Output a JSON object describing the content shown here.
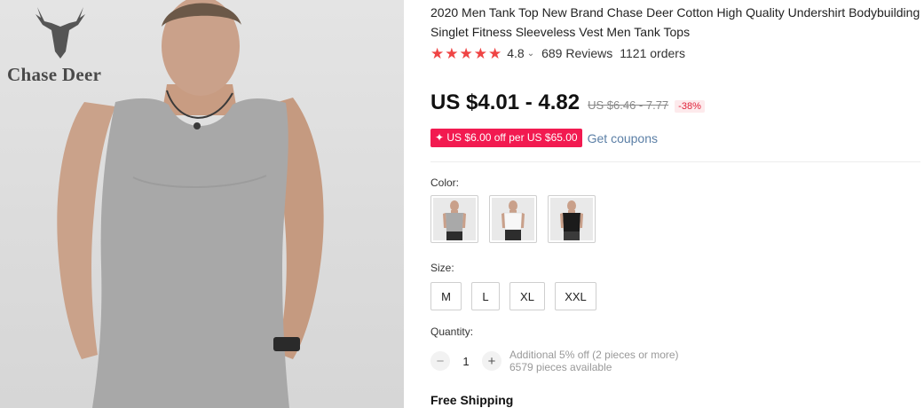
{
  "brand": {
    "logo_text": "Chase Deer",
    "logo_icon": "deer-head-icon"
  },
  "product": {
    "title": "2020 Men Tank Top New Brand Chase Deer Cotton High Quality Undershirt Bodybuilding Singlet Fitness Sleeveless Vest Men Tank Tops",
    "rating": {
      "stars": 5,
      "value": "4.8",
      "reviews": "689 Reviews",
      "orders": "1121 orders"
    },
    "price": {
      "current": "US $4.01 - 4.82",
      "original": "US $6.46 - 7.77",
      "discount": "-38%"
    },
    "coupon": {
      "tag": "✦ US $6.00 off per US $65.00",
      "link": "Get coupons"
    },
    "color": {
      "label": "Color:",
      "options": [
        {
          "name": "gray",
          "shirt_color": "#a9a9a9"
        },
        {
          "name": "white",
          "shirt_color": "#f4f4f4"
        },
        {
          "name": "black",
          "shirt_color": "#1b1b1b"
        }
      ]
    },
    "size": {
      "label": "Size:",
      "options": [
        "M",
        "L",
        "XL",
        "XXL"
      ]
    },
    "quantity": {
      "label": "Quantity:",
      "minus": "−",
      "value": "1",
      "plus": "+",
      "discount_note": "Additional 5% off (2 pieces or more)",
      "available": "6579 pieces available"
    },
    "shipping": "Free Shipping"
  },
  "colors": {
    "star": "#ef4444",
    "coupon_bg": "#f21a50",
    "link": "#5b7fa6",
    "discount": "#e0233a"
  }
}
